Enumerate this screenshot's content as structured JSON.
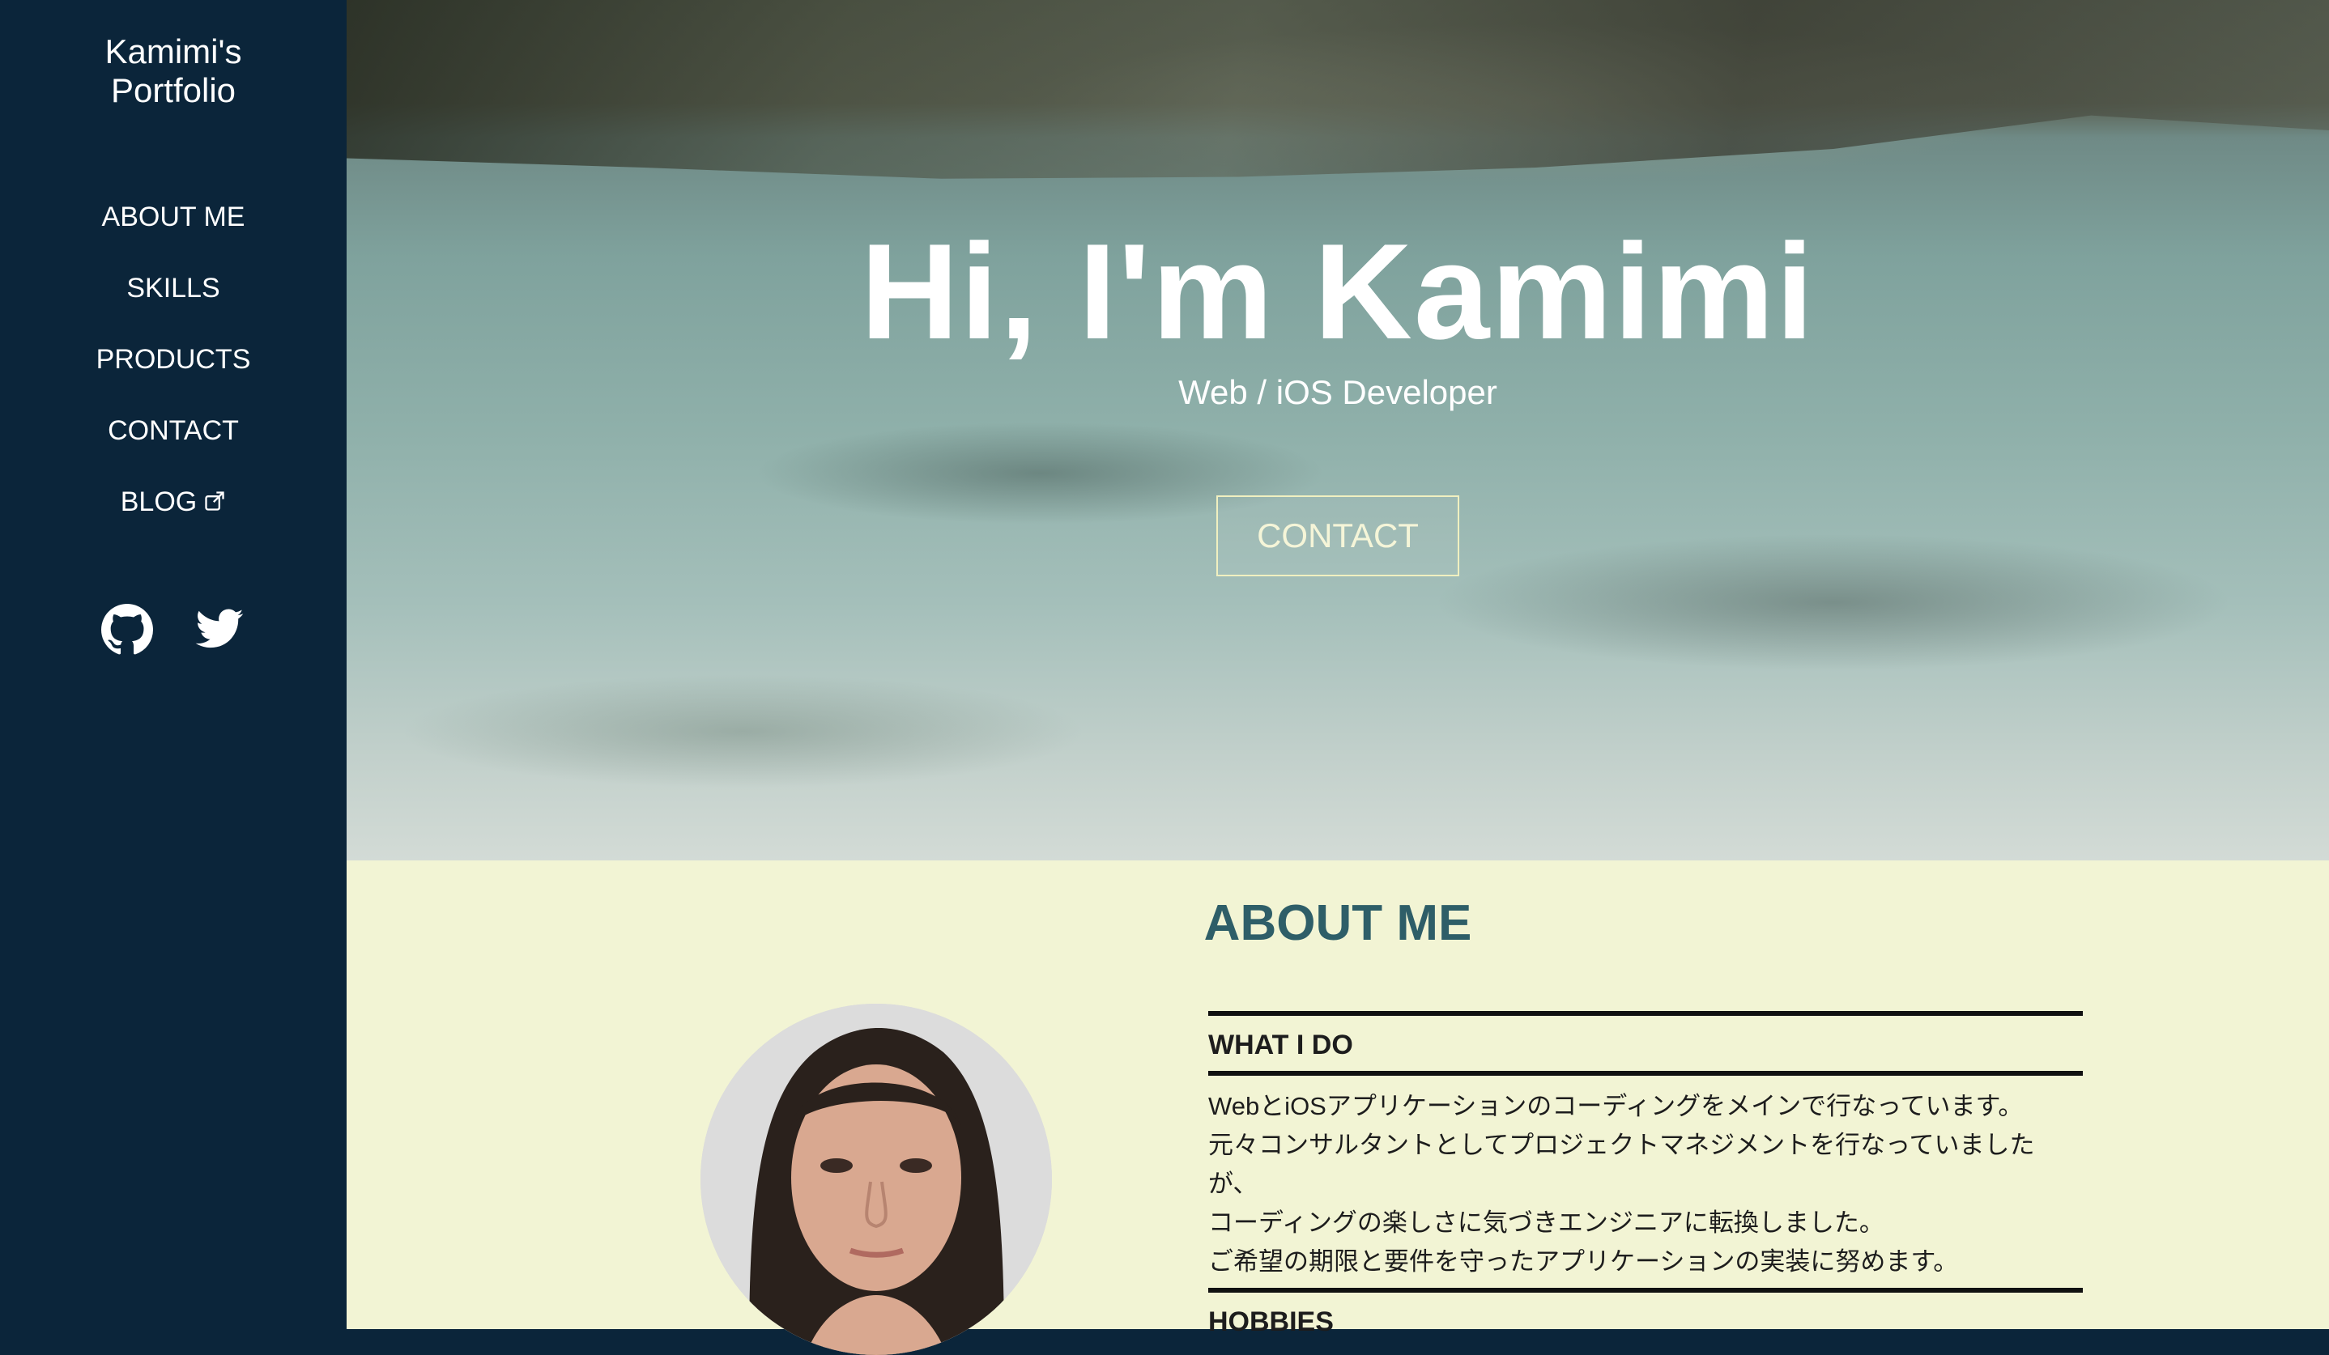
{
  "sidebar": {
    "title_line1": "Kamimi's",
    "title_line2": "Portfolio",
    "nav": [
      {
        "label": "ABOUT ME"
      },
      {
        "label": "SKILLS"
      },
      {
        "label": "PRODUCTS"
      },
      {
        "label": "CONTACT"
      },
      {
        "label": "BLOG",
        "icon": "external-link-icon"
      }
    ],
    "social": [
      "github-icon",
      "twitter-icon"
    ]
  },
  "hero": {
    "title": "Hi, I'm Kamimi",
    "subtitle": "Web / iOS Developer",
    "button_label": "CONTACT"
  },
  "about": {
    "title": "ABOUT ME",
    "what_i_do": {
      "heading": "WHAT I DO",
      "lines": [
        "WebとiOSアプリケーションのコーディングをメインで行なっています。",
        "元々コンサルタントとしてプロジェクトマネジメントを行なっていました",
        "が、",
        "コーディングの楽しさに気づきエンジニアに転換しました。",
        "ご希望の期限と要件を守ったアプリケーションの実装に努めます。"
      ]
    },
    "hobbies": {
      "heading": "HOBBIES"
    }
  },
  "colors": {
    "sidebar_bg": "#0b253a",
    "about_bg": "#f2f4d4",
    "about_title": "#2e5e68"
  }
}
